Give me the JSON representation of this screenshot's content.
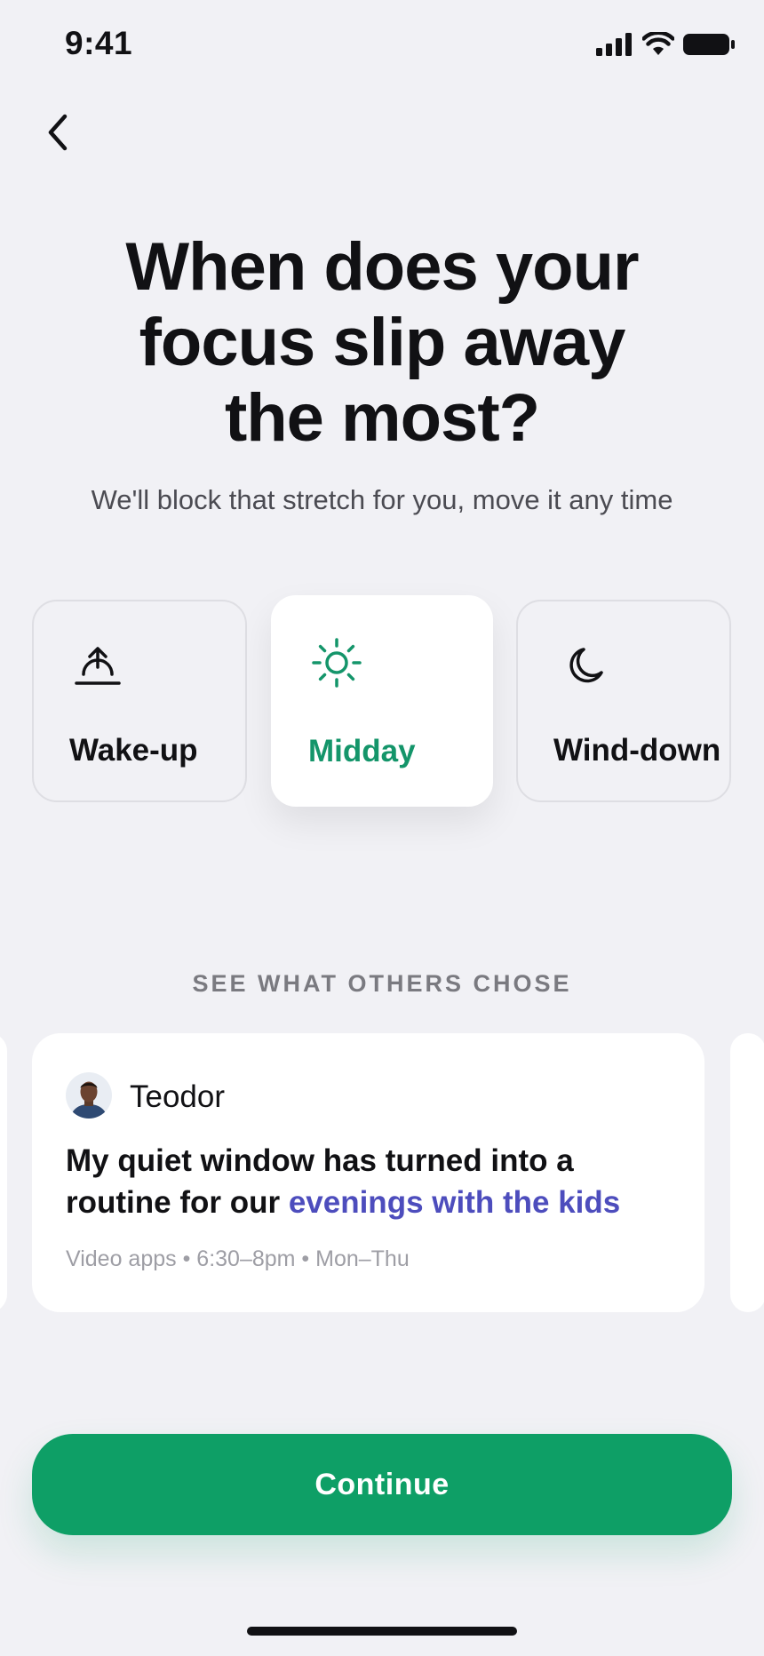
{
  "status_bar": {
    "time": "9:41",
    "icons": [
      "signal-icon",
      "wifi-icon",
      "battery-icon"
    ]
  },
  "nav": {
    "back_icon": "chevron-left-icon"
  },
  "header": {
    "title_line1": "When does your",
    "title_line2": "focus slip away",
    "title_line3": "the most?",
    "subtitle": "We'll block that stretch for you, move it any time"
  },
  "options": [
    {
      "label": "Wake-up",
      "icon": "sunrise-icon",
      "selected": false
    },
    {
      "label": "Midday",
      "icon": "sun-icon",
      "selected": true
    },
    {
      "label": "Wind-down",
      "icon": "moon-icon",
      "selected": false
    }
  ],
  "social": {
    "heading": "SEE WHAT OTHERS CHOSE",
    "testimonial": {
      "name": "Teodor",
      "quote_start": "My quiet window has turned into a routine for our ",
      "quote_highlight": "evenings with the kids",
      "meta": "Video apps • 6:30–8pm • Mon–Thu"
    }
  },
  "cta": {
    "label": "Continue"
  },
  "colors": {
    "accent_green": "#14956a",
    "button_green": "#0e9f66",
    "highlight_purple": "#4d4dbd",
    "background": "#f1f1f5"
  }
}
